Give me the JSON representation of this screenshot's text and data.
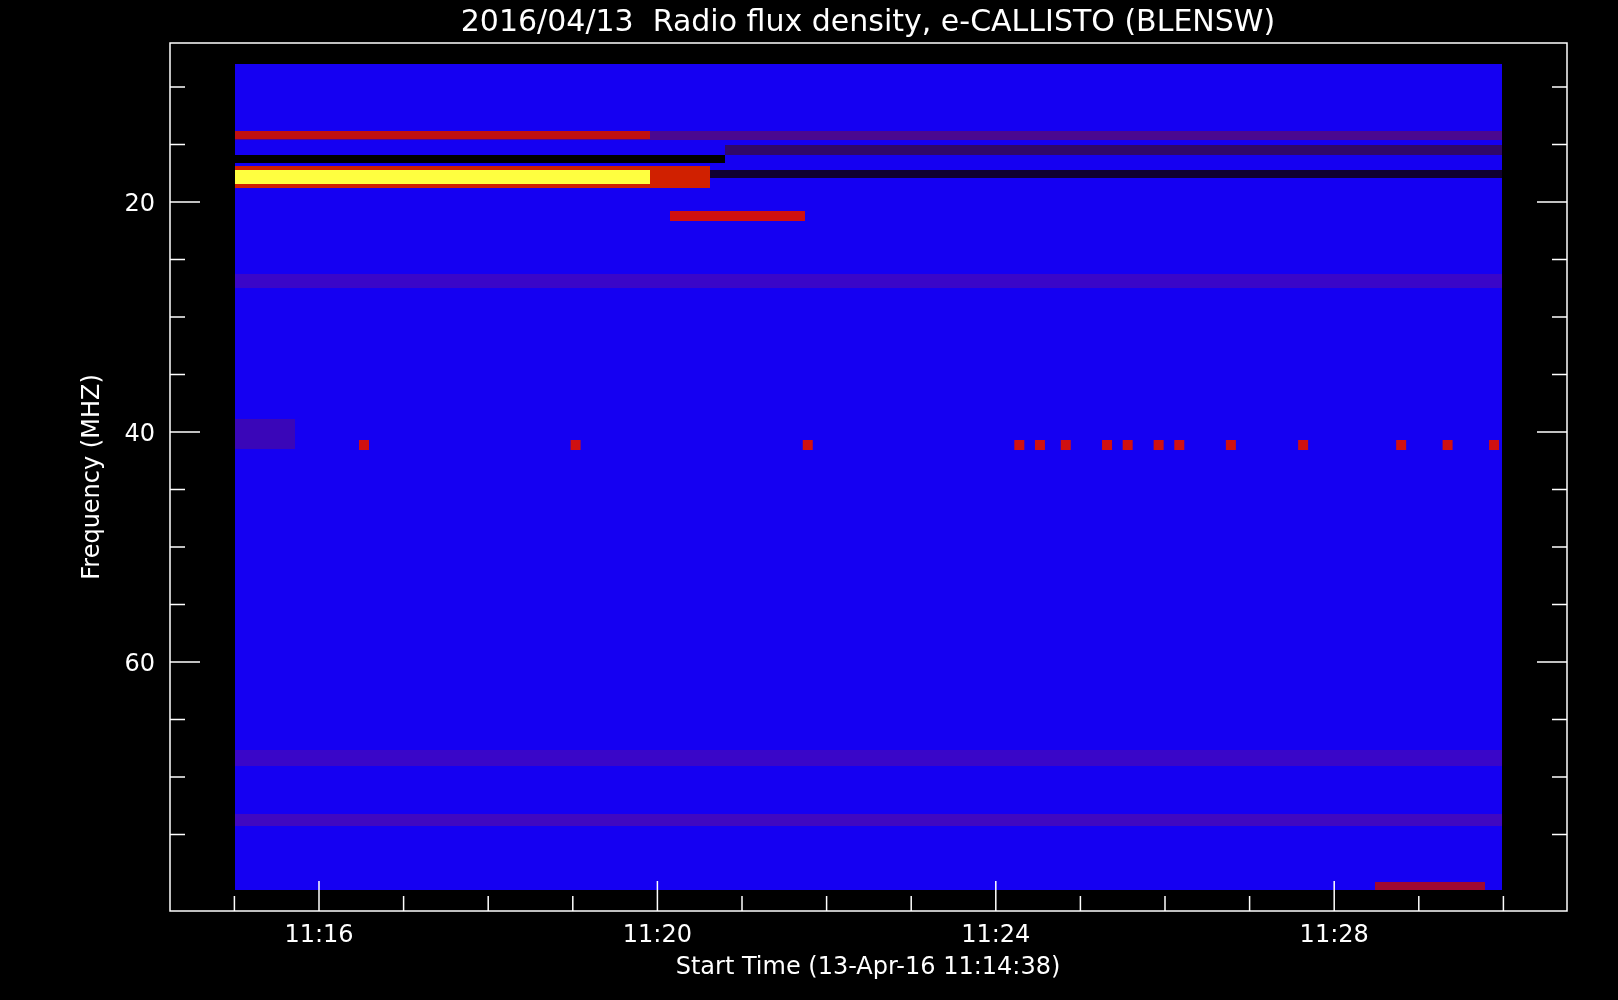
{
  "title": "2016/04/13  Radio flux density, e-CALLISTO (BLENSW)",
  "y_axis": {
    "label": "Frequency (MHZ)",
    "ticks": [
      "20",
      "40",
      "60"
    ]
  },
  "x_axis": {
    "label": "Start Time (13-Apr-16 11:14:38)",
    "ticks": [
      "11:16",
      "11:20",
      "11:24",
      "11:28"
    ]
  }
}
